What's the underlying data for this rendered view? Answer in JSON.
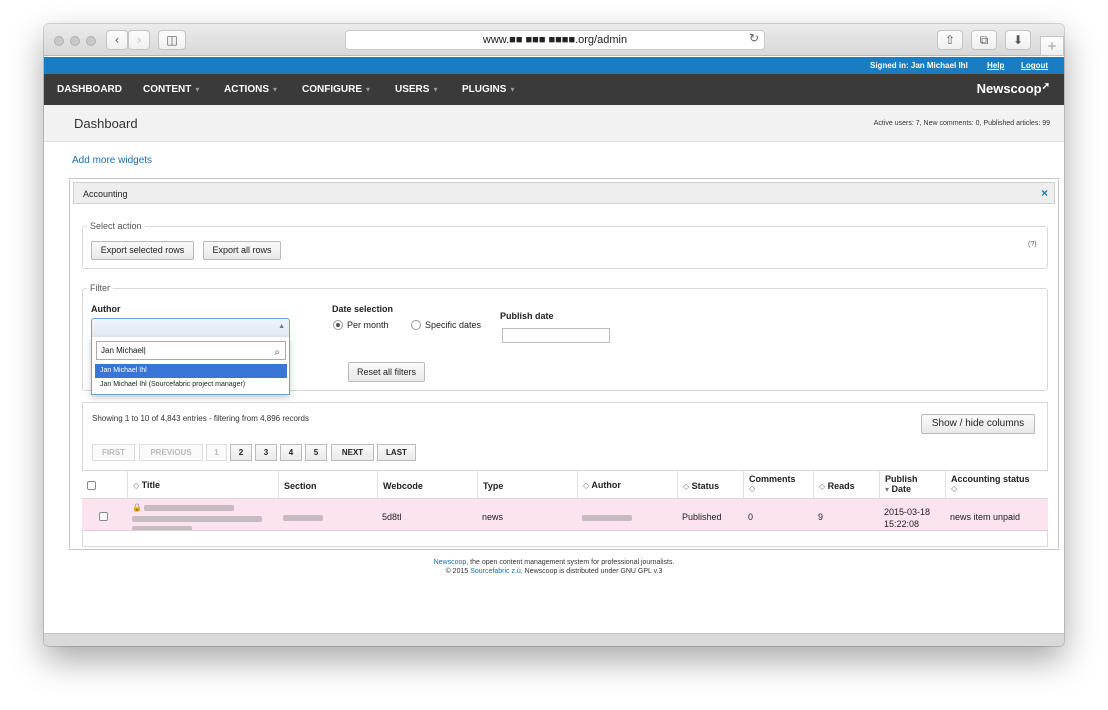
{
  "browser": {
    "url": "www.■■ ■■■ ■■■■.org/admin",
    "back_icon": "chevron-left-icon",
    "forward_icon": "chevron-right-icon",
    "sidebar_icon": "sidebar-icon",
    "share_icon": "share-icon",
    "tabs_icon": "tabs-icon",
    "download_icon": "download-icon",
    "newtab_label": "+"
  },
  "topbar": {
    "signed_in": "Signed in: Jan Michael Ihl",
    "help": "Help",
    "logout": "Logout"
  },
  "menu": {
    "items": [
      {
        "label": "DASHBOARD",
        "caret": ""
      },
      {
        "label": "CONTENT",
        "caret": "▾"
      },
      {
        "label": "ACTIONS",
        "caret": "▾"
      },
      {
        "label": "CONFIGURE",
        "caret": "▾"
      },
      {
        "label": "USERS",
        "caret": "▾"
      },
      {
        "label": "PLUGINS",
        "caret": "▾"
      }
    ],
    "brand": "Newscoop"
  },
  "page": {
    "title": "Dashboard",
    "stats": "Active users: 7, New comments: 0, Published articles: 99",
    "add_widgets": "Add more widgets"
  },
  "widget": {
    "title": "Accounting",
    "close": "×",
    "select_action": {
      "legend": "Select action",
      "export_selected": "Export selected rows",
      "export_all": "Export all rows",
      "help": "(?)"
    },
    "filter": {
      "legend": "Filter",
      "author_label": "Author",
      "author_search_value": "Jan Michael",
      "author_options": [
        "Jan Michael Ihl",
        "Jan Michael Ihl (Sourcefabric project manager)"
      ],
      "date_label": "Date selection",
      "per_month": "Per month",
      "specific_dates": "Specific dates",
      "publish_date_label": "Publish date",
      "reset": "Reset all filters"
    },
    "table": {
      "showing": "Showing 1 to 10 of 4,843 entries - filtering from 4,896 records",
      "show_hide": "Show / hide columns",
      "pager": {
        "first": "FIRST",
        "previous": "PREVIOUS",
        "pages": [
          "1",
          "2",
          "3",
          "4",
          "5"
        ],
        "next": "NEXT",
        "last": "LAST"
      },
      "columns": [
        "Title",
        "Section",
        "Webcode",
        "Type",
        "Author",
        "Status",
        "Comments",
        "Reads",
        "Publish",
        "Date",
        "Accounting status"
      ],
      "rows": [
        {
          "webcode": "5d8tl",
          "type": "news",
          "status": "Published",
          "comments": "0",
          "reads": "9",
          "publish_date": "2015-03-18",
          "publish_time": "15:22:08",
          "accounting_status": "news item unpaid"
        }
      ]
    }
  },
  "footer": {
    "brand_link": "Newscoop",
    "line1_rest": ", the open content management system for professional journalists.",
    "line2_prefix": "© 2015 ",
    "line2_link": "Sourcefabric z.ú.",
    "line2_rest": " Newscoop is distributed under GNU GPL v.3"
  }
}
